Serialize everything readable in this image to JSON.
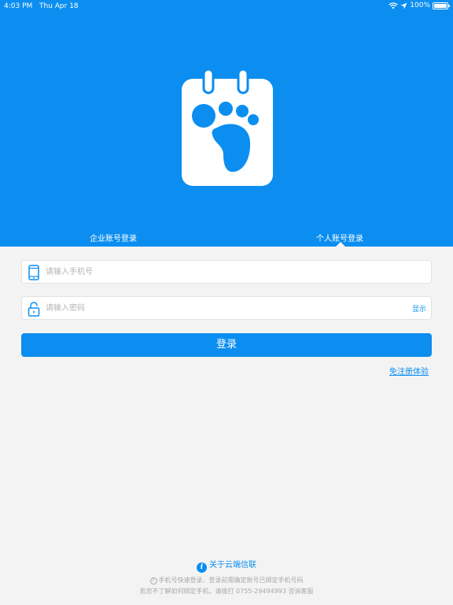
{
  "status_bar": {
    "time": "4:03 PM",
    "date": "Thu Apr 18",
    "battery": "100%",
    "icons": [
      "wifi-icon",
      "location-arrow-icon",
      "battery-icon"
    ]
  },
  "app": {
    "logo_icon": "footprint-calendar-logo-icon",
    "brand_color": "#0b8ef0"
  },
  "tabs": [
    {
      "label": "企业账号登录",
      "active": false
    },
    {
      "label": "个人账号登录",
      "active": true
    }
  ],
  "form": {
    "phone": {
      "placeholder": "请输入手机号",
      "value": "",
      "icon": "phone-icon"
    },
    "password": {
      "placeholder": "请输入密码",
      "value": "",
      "icon": "unlock-icon",
      "toggle_label": "显示"
    },
    "login_label": "登录",
    "trial_link": "免注册体验"
  },
  "footer": {
    "about_label": "关于云端信联",
    "about_icon": "info-icon",
    "note_icon_glyph": "?",
    "note_line1": "手机号快速登录，登录前需确定账号已绑定手机号码",
    "note_line2": "若您不了解如何绑定手机，请拨打 0755-29494993 咨询客服"
  }
}
